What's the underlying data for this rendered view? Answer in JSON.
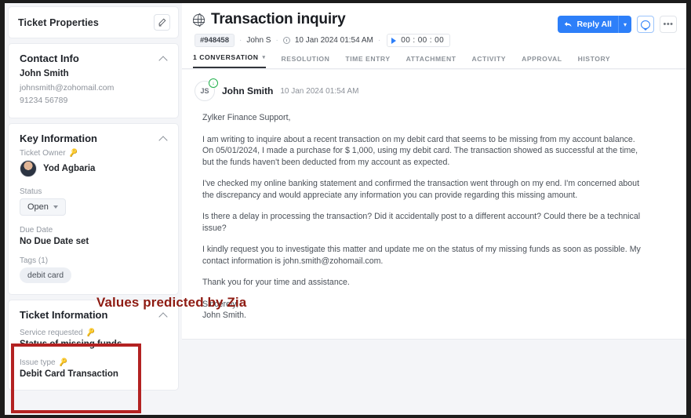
{
  "annotation": {
    "label": "Values predicted by Zia",
    "color": "#8e1b12",
    "box_color": "#b32222"
  },
  "sidebar": {
    "properties_header": {
      "title": "Ticket Properties",
      "edit_icon": "pencil-icon"
    },
    "contact_info": {
      "title": "Contact Info",
      "name": "John Smith",
      "email": "johnsmith@zohomail.com",
      "phone": "91234 56789"
    },
    "key_information": {
      "title": "Key Information",
      "ticket_owner_label": "Ticket Owner",
      "ticket_owner": "Yod Agbaria",
      "status_label": "Status",
      "status_value": "Open",
      "due_date_label": "Due Date",
      "due_date_value": "No Due Date set",
      "tags_label": "Tags (1)",
      "tags": [
        "debit card"
      ]
    },
    "ticket_information": {
      "title": "Ticket Information",
      "fields": [
        {
          "label": "Service requested",
          "value": "Status of missing funds",
          "icon": "zia-key-icon"
        },
        {
          "label": "Issue type",
          "value": "Debit Card Transaction",
          "icon": "zia-key-icon"
        }
      ]
    }
  },
  "header": {
    "title": "Transaction inquiry",
    "channel_icon": "globe-icon",
    "ticket_id": "#948458",
    "requester": "John S",
    "created_icon": "clock-icon",
    "created_at": "10 Jan 2024 01:54 AM",
    "timer_value": "00 : 00 : 00",
    "timer_icon": "play-icon",
    "reply_all_label": "Reply All",
    "reply_all_caret": "▾",
    "comment_icon": "chat-bubble-icon",
    "more_icon": "ellipsis-icon"
  },
  "tabs": [
    {
      "label": "1 CONVERSATION",
      "active": true,
      "caret": "▾"
    },
    {
      "label": "RESOLUTION",
      "active": false
    },
    {
      "label": "TIME ENTRY",
      "active": false
    },
    {
      "label": "ATTACHMENT",
      "active": false
    },
    {
      "label": "ACTIVITY",
      "active": false
    },
    {
      "label": "APPROVAL",
      "active": false
    },
    {
      "label": "HISTORY",
      "active": false
    }
  ],
  "conversation": {
    "avatar_initials": "JS",
    "status_badge": "↓",
    "sender": "John Smith",
    "timestamp": "10 Jan 2024 01:54 AM",
    "paragraphs": [
      "Zylker Finance Support,",
      "I am writing to inquire about a recent transaction on my debit card that seems to be missing from my account balance. On 05/01/2024, I made a purchase for $ 1,000, using my debit card. The transaction showed as successful at the time, but the funds haven't been deducted from my account as expected.",
      "I've checked my online banking statement and confirmed the transaction went through on my end. I'm concerned about the discrepancy and would appreciate any information you can provide regarding this missing amount.",
      "Is there a delay in processing the transaction? Did it accidentally post to a different account? Could there be a technical issue?",
      "I kindly request you to investigate this matter and update me on the status of my missing funds as soon as possible. My contact information is john.smith@zohomail.com.",
      "Thank you for your time and assistance.",
      "Sincerely,\nJohn Smith."
    ]
  }
}
